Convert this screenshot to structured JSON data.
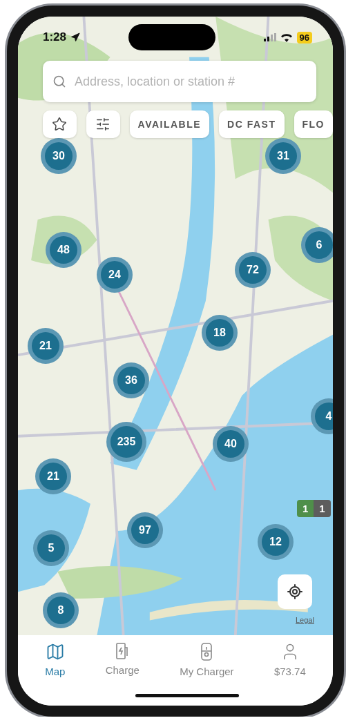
{
  "status_bar": {
    "time": "1:28",
    "battery": "96"
  },
  "search": {
    "placeholder": "Address, location or station #"
  },
  "filters": [
    {
      "label": "AVAILABLE"
    },
    {
      "label": "DC FAST"
    },
    {
      "label": "FLO"
    }
  ],
  "clusters": [
    {
      "count": "30"
    },
    {
      "count": "31"
    },
    {
      "count": "48"
    },
    {
      "count": "24"
    },
    {
      "count": "72"
    },
    {
      "count": "6"
    },
    {
      "count": "21"
    },
    {
      "count": "18"
    },
    {
      "count": "36"
    },
    {
      "count": "235"
    },
    {
      "count": "40"
    },
    {
      "count": "4"
    },
    {
      "count": "21"
    },
    {
      "count": "97"
    },
    {
      "count": "5"
    },
    {
      "count": "12"
    },
    {
      "count": "8"
    }
  ],
  "station_pin": {
    "available": "1",
    "in_use": "1"
  },
  "legal": "Legal",
  "tabs": [
    {
      "label": "Map",
      "selected": true
    },
    {
      "label": "Charge",
      "selected": false
    },
    {
      "label": "My Charger",
      "selected": false
    },
    {
      "label": "$73.74",
      "selected": false
    }
  ]
}
